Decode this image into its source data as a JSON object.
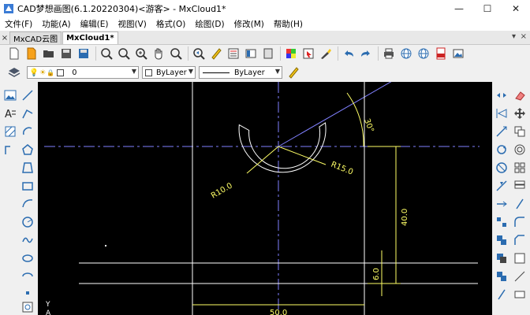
{
  "window": {
    "title": "CAD梦想画图(6.1.20220304)<游客> - MxCloud1*",
    "minimize": "—",
    "maximize": "☐",
    "close": "✕"
  },
  "menu": [
    "文件(F)",
    "功能(A)",
    "编辑(E)",
    "视图(V)",
    "格式(O)",
    "绘图(D)",
    "修改(M)",
    "帮助(H)"
  ],
  "tabs": {
    "close_x": "×",
    "items": [
      "MxCAD云图",
      "MxCloud1*"
    ],
    "active_index": 1,
    "expand": "▾",
    "close_all": "×"
  },
  "props_bar": {
    "layer_value": "0",
    "color_value": "ByLayer",
    "linetype_value": "ByLayer"
  },
  "drawing": {
    "dims": {
      "r_inner": "R10.0",
      "r_outer": "R15.0",
      "angle": "30°",
      "vertical_40": "40.0",
      "vertical_6": "6.0",
      "horizontal_50": "50.0"
    },
    "ucs_y": "Y",
    "ucs_a": "A"
  },
  "colors": {
    "canvas_bg": "#000000",
    "geometry": "#ffffff",
    "dimension": "#ffff66",
    "centerline": "#8080ff"
  }
}
